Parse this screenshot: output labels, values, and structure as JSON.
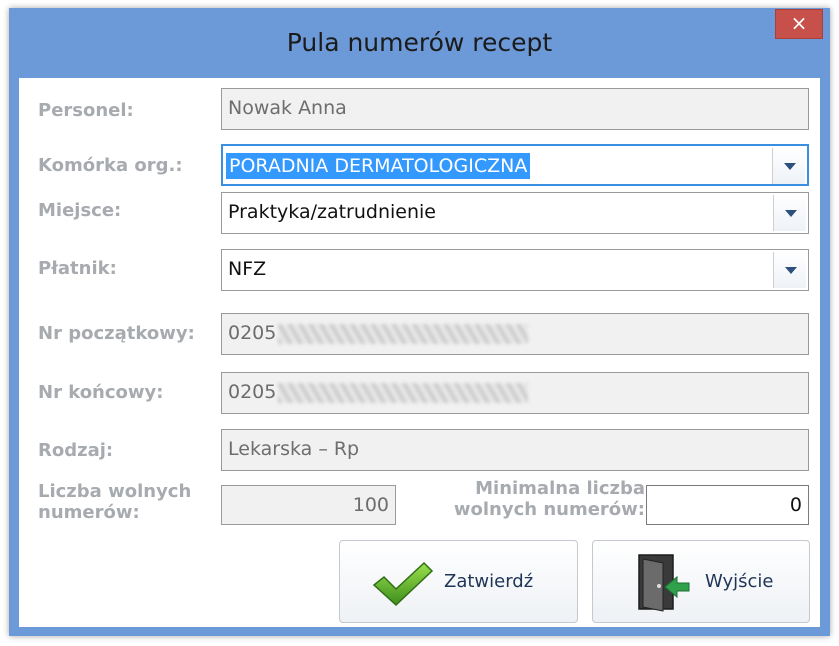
{
  "window": {
    "title": "Pula numerów recept",
    "close_glyph": "×"
  },
  "form": {
    "personel": {
      "label": "Personel:",
      "value": "Nowak Anna"
    },
    "komorka": {
      "label": "Komórka org.:",
      "value": "PORADNIA DERMATOLOGICZNA"
    },
    "miejsce": {
      "label": "Miejsce:",
      "value": "Praktyka/zatrudnienie"
    },
    "platnik": {
      "label": "Płatnik:",
      "value": "NFZ"
    },
    "nr_poczatkowy": {
      "label": "Nr początkowy:",
      "value": "0205"
    },
    "nr_koncowy": {
      "label": "Nr końcowy:",
      "value": "0205"
    },
    "rodzaj": {
      "label": "Rodzaj:",
      "value": "Lekarska – Rp"
    },
    "liczba_wolnych": {
      "label_line1": "Liczba wolnych",
      "label_line2": "numerów:",
      "value": "100"
    },
    "minimalna_liczba": {
      "label_line1": "Minimalna liczba",
      "label_line2": "wolnych numerów:",
      "value": "0"
    }
  },
  "buttons": {
    "zatwierdz": {
      "label": "Zatwierdź",
      "icon": "checkmark-icon"
    },
    "wyjscie": {
      "label": "Wyjście",
      "icon": "exit-door-icon"
    }
  },
  "colors": {
    "titlebar": "#6c9ad8",
    "close": "#c7504a",
    "selection": "#3399ff",
    "label": "#a7abaf"
  }
}
